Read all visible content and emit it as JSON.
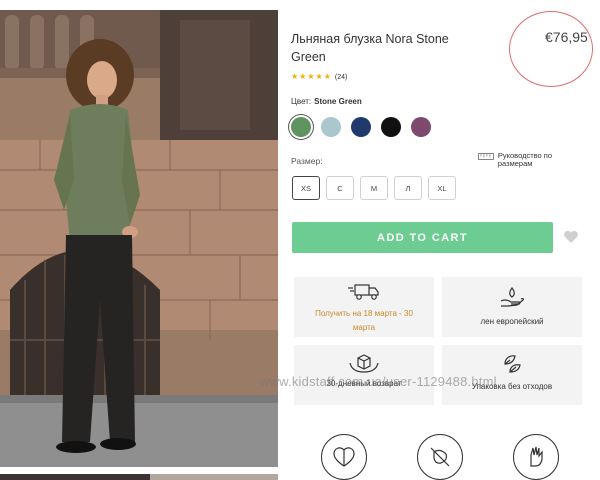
{
  "product": {
    "title": "Льняная блузка Nora Stone Green",
    "price": "€76,95",
    "rating_count": "(24)",
    "stars": 5
  },
  "color": {
    "label": "Цвет:",
    "selected_name": "Stone Green",
    "swatches": [
      "#5f9360",
      "#a9c7cc",
      "#1f3a6b",
      "#111111",
      "#7d4a6e"
    ]
  },
  "size": {
    "label": "Размер:",
    "guide": "Руководство по размерам",
    "options": [
      "XS",
      "С",
      "М",
      "Л",
      "XL"
    ],
    "selected": "XS"
  },
  "cart": {
    "label": "ADD TO CART"
  },
  "features": {
    "delivery": "Получить на 18 марта - 30 марта",
    "linen": "лен европейский",
    "returns": "30-дневный возврат",
    "packaging": "Упаковка без отходов"
  },
  "watermark": "www.kidstaff.com.ua/user-1129488.html",
  "colors": {
    "accent_green": "#6dcc92",
    "star": "#f0b100",
    "annotation_circle": "#e06b6b"
  }
}
